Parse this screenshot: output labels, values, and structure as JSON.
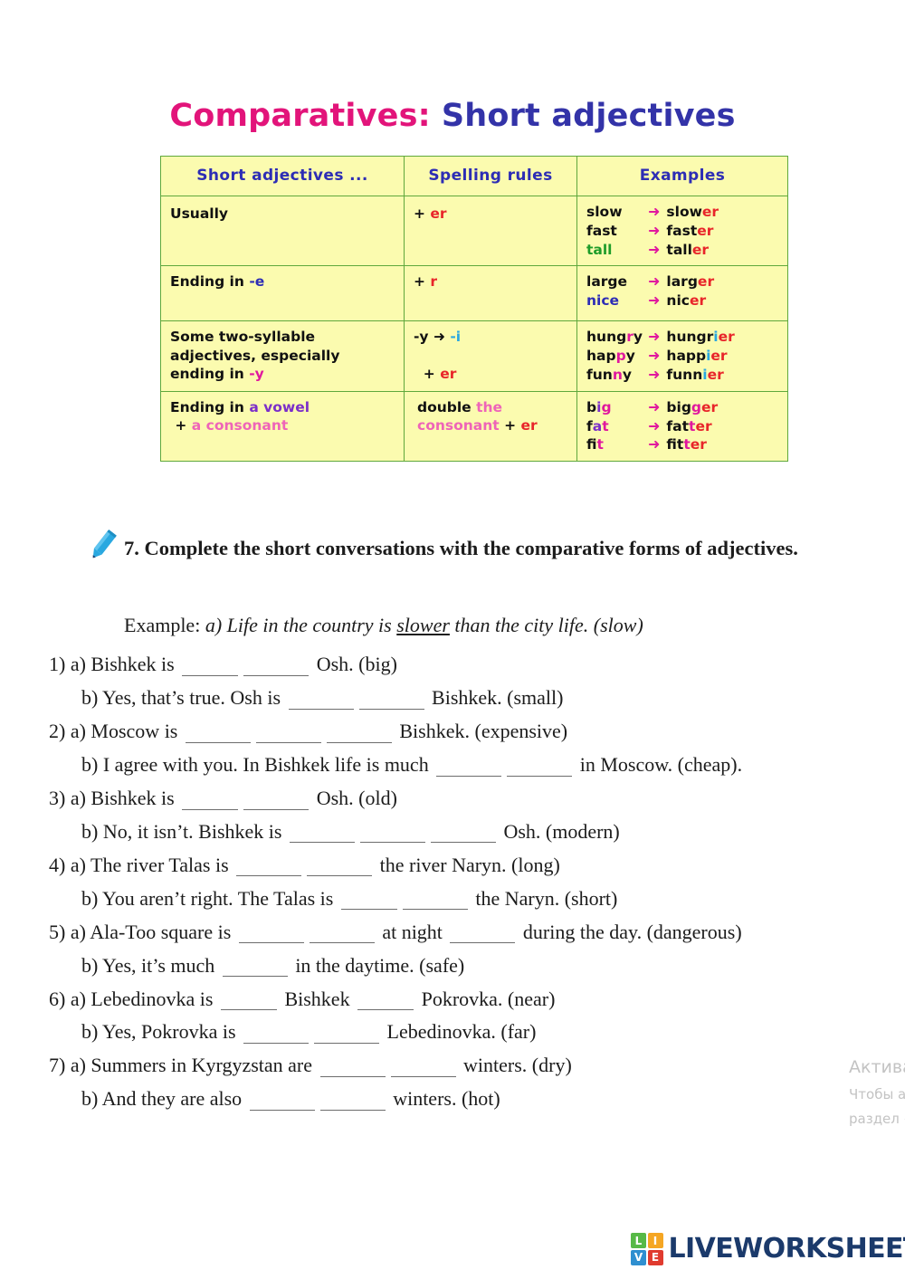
{
  "title": {
    "part1": "Comparatives:",
    "part2": "Short adjectives",
    "color1": "#e2147a",
    "color2": "#3333a8"
  },
  "rules_table": {
    "headers": [
      "Short adjectives ...",
      "Spelling rules",
      "Examples"
    ],
    "rows": [
      {
        "condition": "Usually",
        "rule": "+ er",
        "examples": [
          {
            "from": "slow",
            "to": "slower"
          },
          {
            "from": "fast",
            "to": "faster"
          },
          {
            "from": "tall",
            "to": "taller"
          }
        ]
      },
      {
        "condition": "Ending in -e",
        "rule": "+ r",
        "examples": [
          {
            "from": "large",
            "to": "larger"
          },
          {
            "from": "nice",
            "to": "nicer"
          }
        ]
      },
      {
        "condition": "Some two-syllable adjectives, especially ending in -y",
        "rule": "-y ➔ -i  + er",
        "examples": [
          {
            "from": "hungry",
            "to": "hungrier"
          },
          {
            "from": "happy",
            "to": "happier"
          },
          {
            "from": "funny",
            "to": "funnier"
          }
        ]
      },
      {
        "condition": "Ending in a vowel + a consonant",
        "rule": "double the consonant + er",
        "examples": [
          {
            "from": "big",
            "to": "bigger"
          },
          {
            "from": "fat",
            "to": "fatter"
          },
          {
            "from": "fit",
            "to": "fitter"
          }
        ]
      }
    ],
    "colors": {
      "background": "#fbfbaf",
      "gridline": "#5fa83c",
      "header_text": "#2d2db5",
      "suffix_red": "#e8252a",
      "arrow_magenta": "#e0189e",
      "green": "#1e9c29",
      "blue": "#2d2db5",
      "light_blue": "#2aa8e0",
      "purple": "#7b2fc9",
      "pink": "#ee64b8"
    }
  },
  "task": {
    "number": "7.",
    "instruction": "Complete the short conversations with the comparative forms of adjectives.",
    "example_label": "Example:",
    "example_pre": "a) Life in the country is",
    "example_answer": "slower",
    "example_post": "than the city life. (slow)"
  },
  "exercises": [
    {
      "number": "1)",
      "a": {
        "label": "a)",
        "pre": "Bishkek is",
        "blanks": 2,
        "post": "Osh. (big)"
      },
      "b": {
        "label": "b)",
        "pre": "Yes, that’s true. Osh is",
        "blanks": 2,
        "post": "Bishkek. (small)"
      }
    },
    {
      "number": "2)",
      "a": {
        "label": "a)",
        "pre": "Moscow is",
        "blanks": 3,
        "post": "Bishkek. (expensive)"
      },
      "b": {
        "label": "b)",
        "pre": "I agree with you. In Bishkek life is much",
        "blanks": 2,
        "post": "in Moscow. (cheap)."
      }
    },
    {
      "number": "3)",
      "a": {
        "label": "a)",
        "pre": "Bishkek is",
        "blanks": 2,
        "post": "Osh. (old)"
      },
      "b": {
        "label": "b)",
        "pre": "No, it isn’t. Bishkek is",
        "blanks": 3,
        "post": "Osh. (modern)"
      }
    },
    {
      "number": "4)",
      "a": {
        "label": "a)",
        "pre": "The river Talas is",
        "blanks": 2,
        "post": "the river Naryn. (long)"
      },
      "b": {
        "label": "b)",
        "pre": "You aren’t right. The Talas is",
        "blanks": 2,
        "post": "the Naryn. (short)"
      }
    },
    {
      "number": "5)",
      "a": {
        "label": "a)",
        "pre": "Ala-Too square is",
        "blanks": 2,
        "mid": "at night",
        "blanks2": 1,
        "post": "during the day. (dangerous)"
      },
      "b": {
        "label": "b)",
        "pre": "Yes, it’s much",
        "blanks": 1,
        "post": "in the daytime. (safe)"
      }
    },
    {
      "number": "6)",
      "a": {
        "label": "a)",
        "pre": "Lebedinovka is",
        "blanks": 1,
        "mid": "Bishkek",
        "blanks2": 1,
        "post": "Pokrovka. (near)"
      },
      "b": {
        "label": "b)",
        "pre": "Yes, Pokrovka is",
        "blanks": 2,
        "post": "Lebedinovka. (far)"
      }
    },
    {
      "number": "7)",
      "a": {
        "label": "a)",
        "pre": "Summers in Kyrgyzstan are",
        "blanks": 2,
        "post": "winters. (dry)"
      },
      "b": {
        "label": "b)",
        "pre": "And they are also",
        "blanks": 2,
        "post": "winters. (hot)"
      }
    }
  ],
  "watermark": {
    "line1": "Активация Windows",
    "line2": "Чтобы активировать Windows, перейдите в",
    "line3": "раздел «Параметры»."
  },
  "footer": {
    "logo_letters": [
      "L",
      "I",
      "V",
      "E"
    ],
    "brand": "LIVEWORKSHEETS",
    "brand_color": "#1b3a6b"
  }
}
